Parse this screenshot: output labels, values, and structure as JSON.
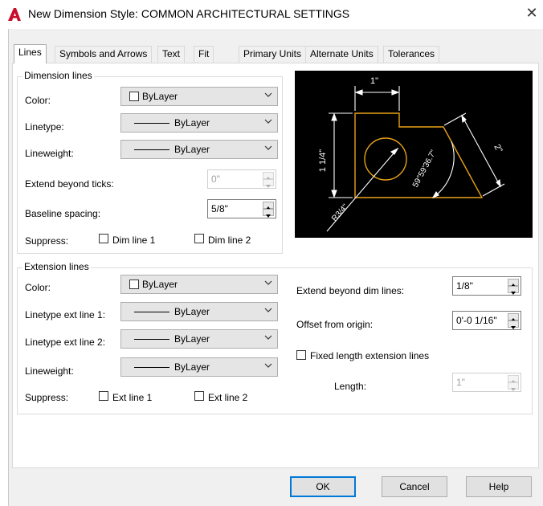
{
  "window": {
    "title": "New Dimension Style: COMMON ARCHITECTURAL SETTINGS",
    "close_glyph": "✕"
  },
  "tabs": [
    "Lines",
    "Symbols and Arrows",
    "Text",
    "Fit",
    "Primary Units",
    "Alternate Units",
    "Tolerances"
  ],
  "active_tab": "Lines",
  "dimension_lines": {
    "group_label": "Dimension lines",
    "color_label": "Color:",
    "color_value": "ByLayer",
    "linetype_label": "Linetype:",
    "linetype_value": "ByLayer",
    "lineweight_label": "Lineweight:",
    "lineweight_value": "ByLayer",
    "extend_ticks_label": "Extend beyond ticks:",
    "extend_ticks_value": "0\"",
    "baseline_label": "Baseline spacing:",
    "baseline_value": "5/8\"",
    "suppress_label": "Suppress:",
    "dim_line_1": "Dim line 1",
    "dim_line_2": "Dim line 2"
  },
  "extension_lines": {
    "group_label": "Extension lines",
    "color_label": "Color:",
    "color_value": "ByLayer",
    "linetype1_label": "Linetype ext line 1:",
    "linetype1_value": "ByLayer",
    "linetype2_label": "Linetype ext line 2:",
    "linetype2_value": "ByLayer",
    "lineweight_label": "Lineweight:",
    "lineweight_value": "ByLayer",
    "suppress_label": "Suppress:",
    "ext_line_1": "Ext line 1",
    "ext_line_2": "Ext line 2",
    "extend_dim_label": "Extend beyond dim lines:",
    "extend_dim_value": "1/8\"",
    "offset_label": "Offset from origin:",
    "offset_value": "0'-0 1/16\"",
    "fixed_length_label": "Fixed length extension lines",
    "length_label": "Length:",
    "length_value": "1\""
  },
  "preview": {
    "dim_top": "1\"",
    "dim_left": "1 1/4\"",
    "dim_right": "2\"",
    "dim_angle": "59°59'36.7\"",
    "dim_radius": "R3/4\""
  },
  "buttons": {
    "ok": "OK",
    "cancel": "Cancel",
    "help": "Help"
  },
  "colors": {
    "accent": "#0078d7",
    "autocad_red": "#c8102e",
    "preview_geometry": "#e8a317",
    "preview_dimension": "#ffffff",
    "preview_bg": "#000000"
  },
  "icons": [
    "autocad-logo-icon",
    "close-icon",
    "chevron-down-icon",
    "spin-up-icon",
    "spin-down-icon"
  ]
}
